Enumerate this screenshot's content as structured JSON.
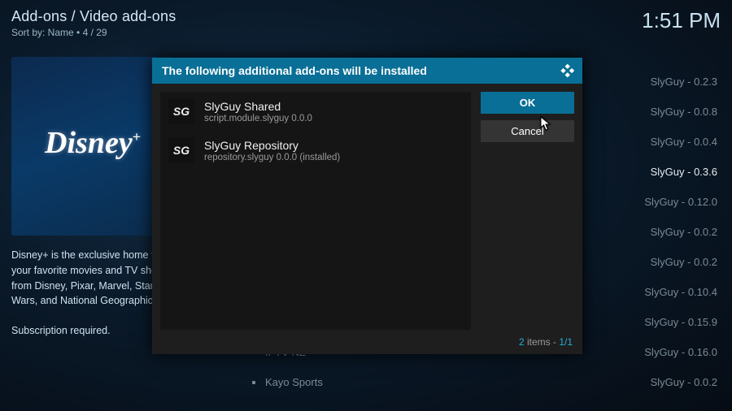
{
  "header": {
    "breadcrumb": "Add-ons / Video add-ons",
    "sort_label": "Sort by: Name",
    "count_sep": " • ",
    "count": "4 / 29"
  },
  "clock": "1:51 PM",
  "poster": {
    "logo_text": "Disney",
    "plus": "+"
  },
  "desc": {
    "p1": "Disney+ is the exclusive home for your favorite movies and TV shows from Disney, Pixar, Marvel, Star Wars, and National Geographic.",
    "p2": "Subscription required."
  },
  "bg_rows": [
    {
      "name": "",
      "meta": "SlyGuy - 0.2.3"
    },
    {
      "name": "",
      "meta": "SlyGuy - 0.0.8"
    },
    {
      "name": "",
      "meta": "SlyGuy - 0.0.4"
    },
    {
      "name": "",
      "meta": "SlyGuy - 0.3.6",
      "highlight": true
    },
    {
      "name": "",
      "meta": "SlyGuy - 0.12.0"
    },
    {
      "name": "",
      "meta": "SlyGuy - 0.0.2"
    },
    {
      "name": "",
      "meta": "SlyGuy - 0.0.2"
    },
    {
      "name": "",
      "meta": "SlyGuy - 0.10.4"
    },
    {
      "name": "",
      "meta": "SlyGuy - 0.15.9"
    },
    {
      "name": "IPTV NZ",
      "meta": "SlyGuy - 0.16.0"
    },
    {
      "name": "Kayo Sports",
      "meta": "SlyGuy - 0.0.2"
    }
  ],
  "dialog": {
    "title": "The following additional add-ons will be installed",
    "deps": [
      {
        "icon": "SG",
        "name": "SlyGuy Shared",
        "sub": "script.module.slyguy 0.0.0"
      },
      {
        "icon": "SG",
        "name": "SlyGuy Repository",
        "sub": "repository.slyguy 0.0.0 (installed)"
      }
    ],
    "ok_label": "OK",
    "cancel_label": "Cancel",
    "footer_count": "2",
    "footer_items": " items - ",
    "footer_page": "1/1"
  }
}
